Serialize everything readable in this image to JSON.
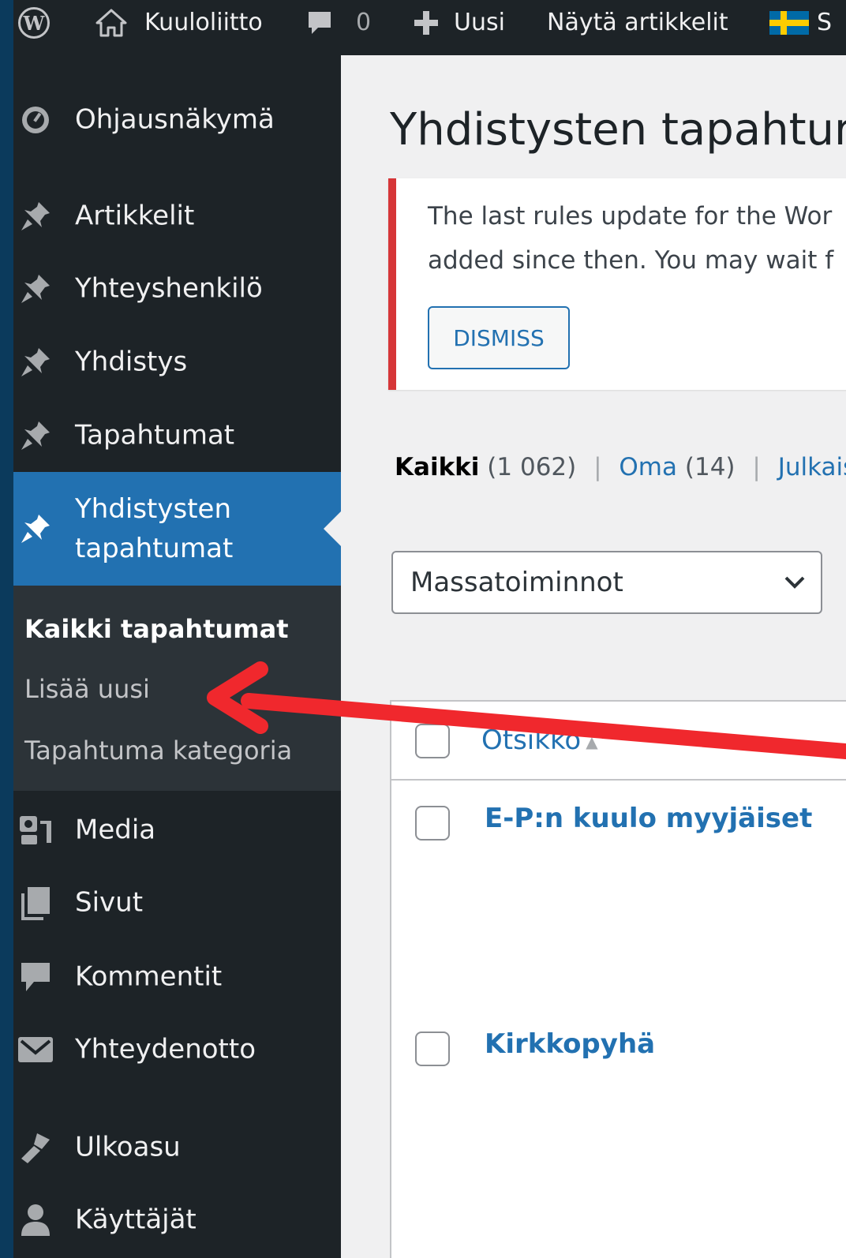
{
  "admin_bar": {
    "site_name": "Kuuloliitto",
    "comments_count": "0",
    "new_label": "Uusi",
    "view_label": "Näytä artikkelit",
    "lang_label": "S"
  },
  "sidebar": {
    "items": [
      {
        "label": "Ohjausnäkymä",
        "icon": "dashboard-icon"
      },
      {
        "label": "Artikkelit",
        "icon": "pin-icon"
      },
      {
        "label": "Yhteyshenkilö",
        "icon": "pin-icon"
      },
      {
        "label": "Yhdistys",
        "icon": "pin-icon"
      },
      {
        "label": "Tapahtumat",
        "icon": "pin-icon"
      },
      {
        "label": "Yhdistysten tapahtumat",
        "icon": "pin-icon"
      },
      {
        "label": "Media",
        "icon": "media-icon"
      },
      {
        "label": "Sivut",
        "icon": "pages-icon"
      },
      {
        "label": "Kommentit",
        "icon": "comment-icon"
      },
      {
        "label": "Yhteydenotto",
        "icon": "mail-icon"
      },
      {
        "label": "Ulkoasu",
        "icon": "appearance-icon"
      },
      {
        "label": "Käyttäjät",
        "icon": "users-icon"
      }
    ],
    "submenu": [
      {
        "label": "Kaikki tapahtumat"
      },
      {
        "label": "Lisää uusi"
      },
      {
        "label": "Tapahtuma kategoria"
      }
    ]
  },
  "main": {
    "title": "Yhdistysten tapahtur",
    "notice": {
      "line1": "The last rules update for the Wor",
      "line2": "added since then. You may wait f",
      "dismiss": "DISMISS"
    },
    "views": {
      "all_label": "Kaikki",
      "all_count": "(1 062)",
      "sep1": "|",
      "mine_label": "Oma",
      "mine_count": "(14)",
      "sep2": "|",
      "published_label": "Julkaist"
    },
    "bulk_actions": "Massatoiminnot",
    "table": {
      "col_title": "Otsikko",
      "rows": [
        {
          "title": "E-P:n kuulo myyjäiset"
        },
        {
          "title": "Kirkkopyhä"
        }
      ]
    }
  },
  "colors": {
    "admin_bar": "#1d2327",
    "sidebar": "#1d2327",
    "submenu": "#2c3338",
    "accent": "#2271b1",
    "notice_error": "#d63638",
    "annotation_arrow": "#f0282d"
  }
}
